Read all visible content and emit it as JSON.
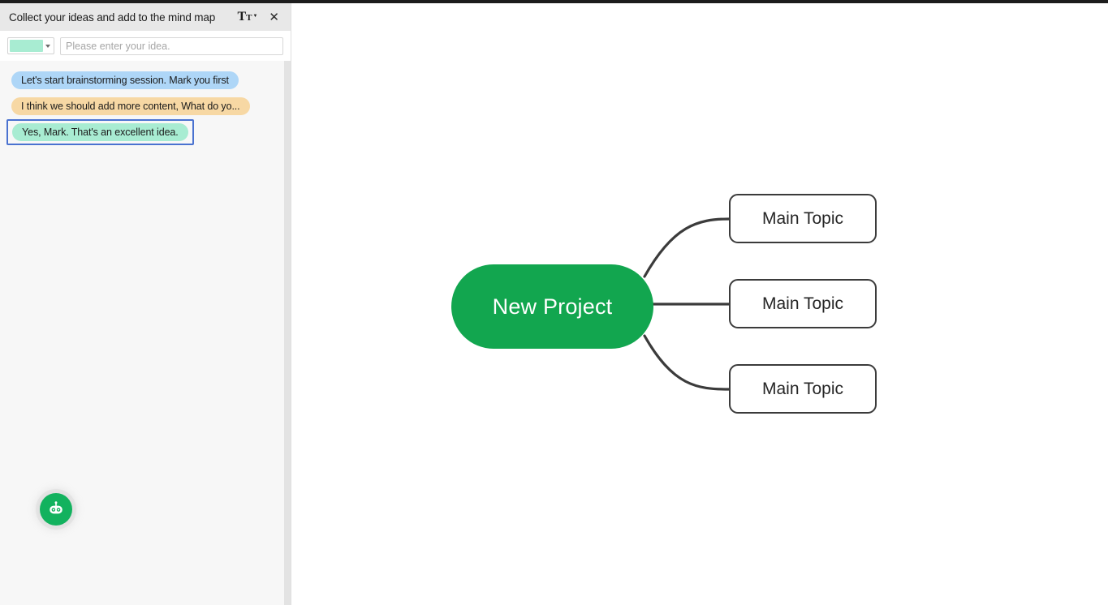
{
  "panel": {
    "title": "Collect your ideas and add to the mind map",
    "font_style_icon": "text-style-icon",
    "font_style_big": "T",
    "font_style_small": "T",
    "close_icon": "✕",
    "input": {
      "placeholder": "Please enter your idea.",
      "value": "",
      "swatch_color": "#a8ecd2",
      "swatch_name": "color-swatch"
    },
    "ideas": [
      {
        "text": "Let's start brainstorming session. Mark you first",
        "color": "#aed6f7",
        "selected": false
      },
      {
        "text": "I think we should add more content, What do yo...",
        "color": "#f7d8a4",
        "selected": false
      },
      {
        "text": "Yes, Mark. That's an excellent idea.",
        "color": "#a8ecd2",
        "selected": true
      }
    ],
    "assistant_button": {
      "name": "ai-assistant-icon",
      "color": "#12b25e"
    }
  },
  "mindmap": {
    "root": {
      "label": "New Project",
      "fill": "#12a64f",
      "text_color": "#ffffff"
    },
    "topics": [
      {
        "label": "Main Topic"
      },
      {
        "label": "Main Topic"
      },
      {
        "label": "Main Topic"
      }
    ],
    "connector_color": "#3b3b3b"
  }
}
